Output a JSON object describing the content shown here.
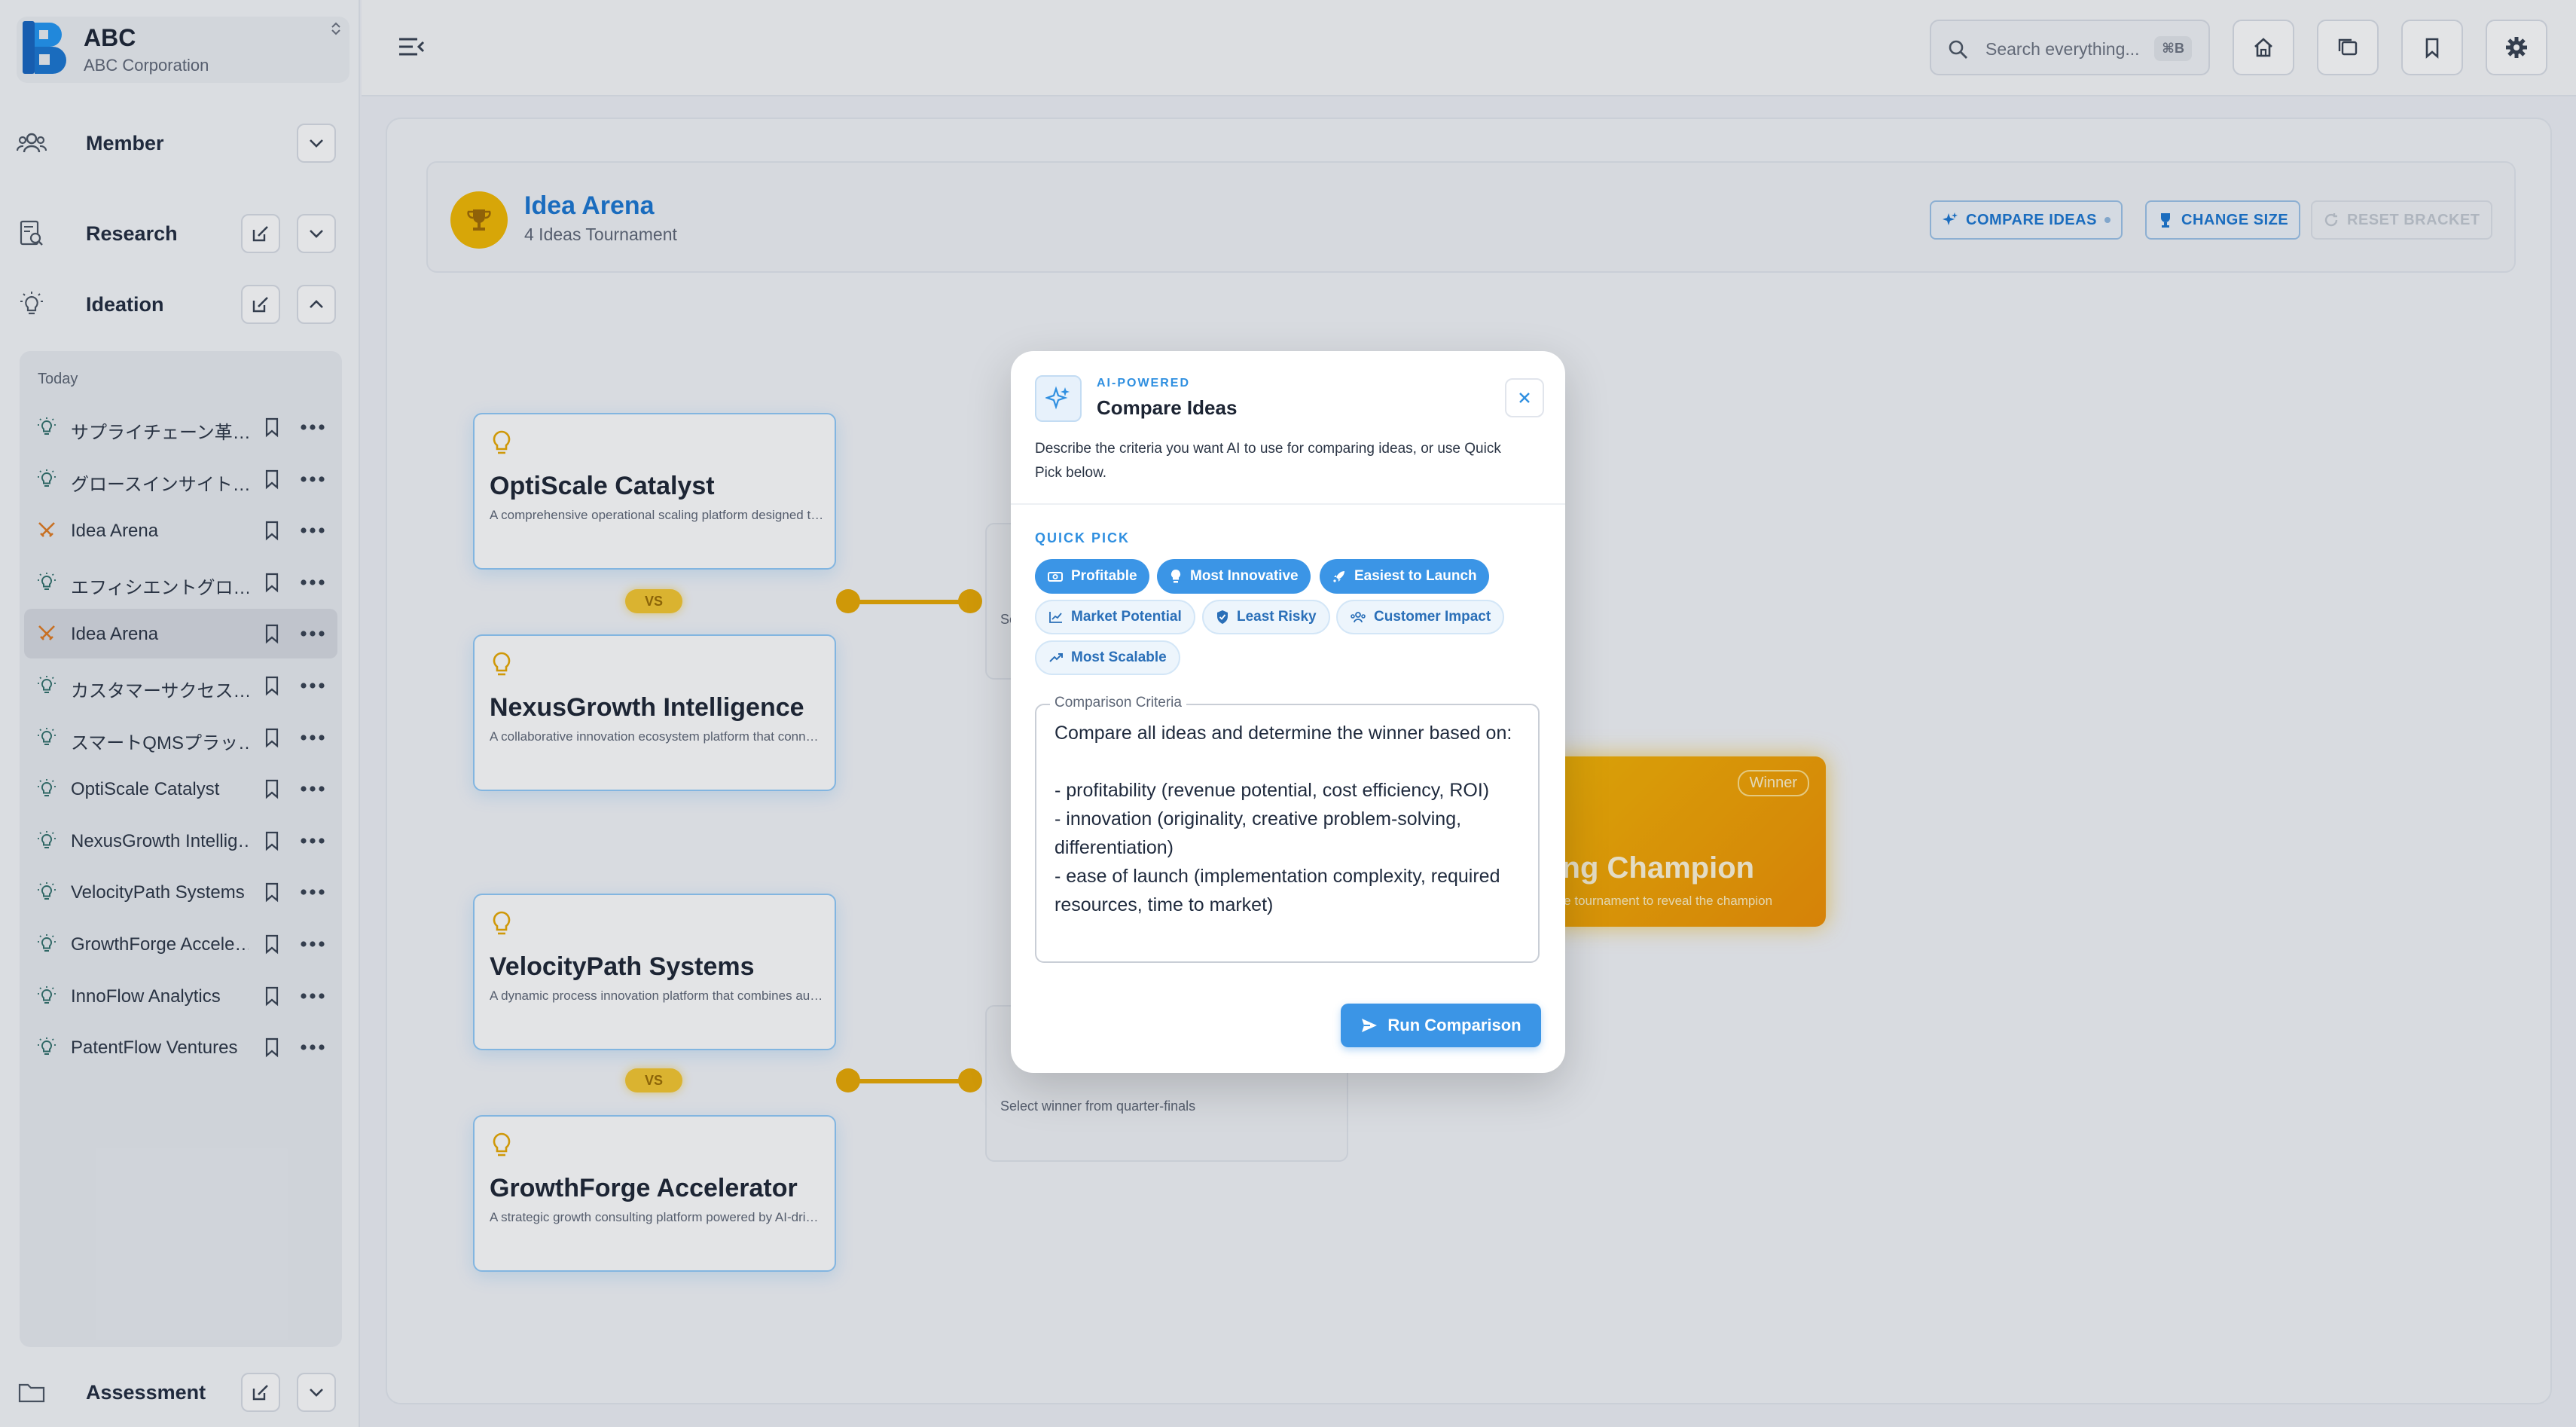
{
  "brand": {
    "name": "ABC",
    "subtitle": "ABC Corporation",
    "collapse_glyph": "⌃⌄"
  },
  "sidebar": {
    "sections": [
      {
        "label": "Member",
        "icon": "group-icon"
      },
      {
        "label": "Research",
        "icon": "research-icon"
      },
      {
        "label": "Ideation",
        "icon": "lightbulb-icon"
      },
      {
        "label": "Assessment",
        "icon": "folder-icon"
      }
    ],
    "group_label": "Today",
    "items": [
      {
        "label": "サプライチェーン革…",
        "icon": "lightbulb-icon"
      },
      {
        "label": "グロースインサイト…",
        "icon": "lightbulb-icon"
      },
      {
        "label": "Idea Arena",
        "icon": "swords-icon"
      },
      {
        "label": "エフィシエントグロ…",
        "icon": "lightbulb-icon"
      },
      {
        "label": "Idea Arena",
        "icon": "swords-icon",
        "active": true
      },
      {
        "label": "カスタマーサクセス…",
        "icon": "lightbulb-icon"
      },
      {
        "label": "スマートQMSプラッ…",
        "icon": "lightbulb-icon"
      },
      {
        "label": "OptiScale Catalyst",
        "icon": "lightbulb-icon"
      },
      {
        "label": "NexusGrowth Intellig…",
        "icon": "lightbulb-icon"
      },
      {
        "label": "VelocityPath Systems",
        "icon": "lightbulb-icon"
      },
      {
        "label": "GrowthForge Accele…",
        "icon": "lightbulb-icon"
      },
      {
        "label": "InnoFlow Analytics",
        "icon": "lightbulb-icon"
      },
      {
        "label": "PatentFlow Ventures",
        "icon": "lightbulb-icon"
      }
    ]
  },
  "topbar": {
    "search_placeholder": "Search everything...",
    "search_shortcut": "⌘B"
  },
  "arena": {
    "title": "Idea Arena",
    "subtitle": "4 Ideas Tournament",
    "buttons": {
      "compare": "COMPARE IDEAS",
      "change_size": "CHANGE SIZE",
      "reset": "RESET BRACKET"
    },
    "vs_label": "VS",
    "ideas": [
      {
        "title": "OptiScale Catalyst",
        "desc": "A comprehensive operational scaling platform designed to help businesses grow efficiently"
      },
      {
        "title": "NexusGrowth Intelligence",
        "desc": "A collaborative innovation ecosystem platform that connects teams and ideas"
      },
      {
        "title": "VelocityPath Systems",
        "desc": "A dynamic process innovation platform that combines automation and analytics"
      },
      {
        "title": "GrowthForge Accelerator",
        "desc": "A strategic growth consulting platform powered by AI-driven insights"
      }
    ],
    "semi_final_label": "Select winner from quarter-finals",
    "semi_final_top_partial": "Se",
    "champion": {
      "badge": "Winner",
      "title": "iting Champion",
      "subtitle": "the tournament to reveal the champion"
    }
  },
  "modal": {
    "kicker": "AI-POWERED",
    "title": "Compare Ideas",
    "description": "Describe the criteria you want AI to use for comparing ideas, or use Quick Pick below.",
    "quick_pick_label": "QUICK PICK",
    "chips": [
      {
        "label": "Profitable",
        "selected": true
      },
      {
        "label": "Most Innovative",
        "selected": true
      },
      {
        "label": "Easiest to Launch",
        "selected": true
      },
      {
        "label": "Market Potential",
        "selected": false
      },
      {
        "label": "Least Risky",
        "selected": false
      },
      {
        "label": "Customer Impact",
        "selected": false
      },
      {
        "label": "Most Scalable",
        "selected": false
      }
    ],
    "criteria_label": "Comparison Criteria",
    "criteria_value": "Compare all ideas and determine the winner based on:\n\n- profitability (revenue potential, cost efficiency, ROI)\n- innovation (originality, creative problem-solving, differentiation)\n- ease of launch (implementation complexity, required resources, time to market)",
    "run_button": "Run Comparison"
  },
  "colors": {
    "primary": "#3b95e6",
    "accent_gold": "#f2b800",
    "text_dark": "#1c2433"
  }
}
